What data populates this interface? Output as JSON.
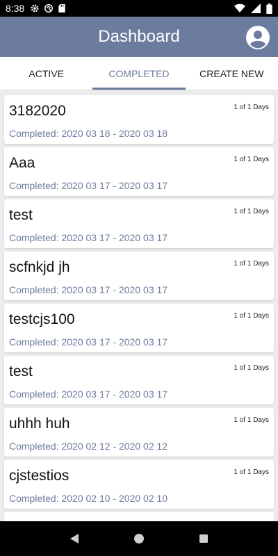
{
  "status_bar": {
    "time": "8:38"
  },
  "app_bar": {
    "title": "Dashboard"
  },
  "tabs": [
    {
      "label": "ACTIVE"
    },
    {
      "label": "COMPLETED"
    },
    {
      "label": "CREATE NEW"
    }
  ],
  "items": [
    {
      "name": "3182020",
      "days": "1 of 1 Days",
      "completed": "Completed: 2020 03 18 - 2020 03 18"
    },
    {
      "name": "Aaa",
      "days": "1 of 1 Days",
      "completed": "Completed: 2020 03 17 - 2020 03 17"
    },
    {
      "name": "test",
      "days": "1 of 1 Days",
      "completed": "Completed: 2020 03 17 - 2020 03 17"
    },
    {
      "name": "scfnkjd jh",
      "days": "1 of 1 Days",
      "completed": "Completed: 2020 03 17 - 2020 03 17"
    },
    {
      "name": "testcjs100",
      "days": "1 of 1 Days",
      "completed": "Completed: 2020 03 17 - 2020 03 17"
    },
    {
      "name": "test",
      "days": "1 of 1 Days",
      "completed": "Completed: 2020 03 17 - 2020 03 17"
    },
    {
      "name": "uhhh huh",
      "days": "1 of 1 Days",
      "completed": "Completed: 2020 02 12 - 2020 02 12"
    },
    {
      "name": "cjstestios",
      "days": "1 of 1 Days",
      "completed": "Completed: 2020 02 10 - 2020 02 10"
    }
  ],
  "colors": {
    "accent": "#6c7c9e",
    "background": "#ececec"
  }
}
